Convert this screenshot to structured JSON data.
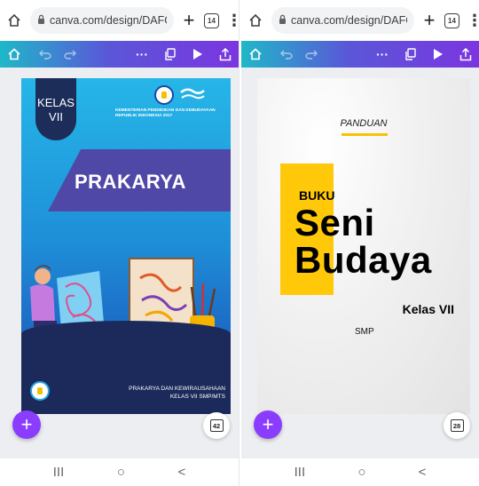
{
  "left_pane": {
    "browser": {
      "url": "canva.com/design/DAFG",
      "tab_count": "14",
      "new_tab": "+",
      "menu": "⋮"
    },
    "toolbar": {
      "more": "···"
    },
    "cover": {
      "kelas": "KELAS VII",
      "ministry": "KEMENTERIAN PENDIDIKAN DAN KEBUDAYAAN REPUBLIK INDONESIA 2017",
      "title": "PRAKARYA",
      "footer_line1": "PRAKARYA DAN KEWIRAUSAHAAN",
      "footer_line2": "KELAS VII SMP/MTS"
    },
    "page_count": "42",
    "add_label": "+"
  },
  "right_pane": {
    "browser": {
      "url": "canva.com/design/DAFG",
      "tab_count": "14",
      "new_tab": "+",
      "menu": "⋮"
    },
    "toolbar": {
      "more": "···"
    },
    "cover": {
      "panduan": "PANDUAN",
      "buku": "BUKU",
      "seni": "Seni",
      "budaya": "Budaya",
      "kelas": "Kelas VII",
      "smp": "SMP"
    },
    "page_count": "28",
    "add_label": "+"
  },
  "nav": {
    "recents": "III",
    "home": "○",
    "back": "<"
  },
  "colors": {
    "canva_purple": "#8b3dff",
    "toolbar_start": "#1fb8c8",
    "toolbar_end": "#7b35e0",
    "cover_blue": "#1e8fd8",
    "banner_purple": "#5048a6",
    "accent_yellow": "#ffc90a"
  }
}
